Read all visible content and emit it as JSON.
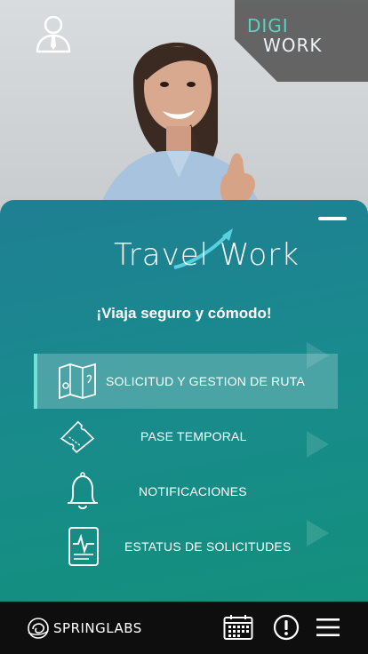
{
  "header": {
    "brand_digi": "DIGI",
    "brand_work": "WORK",
    "user_icon": "user-tie-icon"
  },
  "panel": {
    "logo_text": "Travel Work",
    "tagline": "¡Viaja seguro y cómodo!"
  },
  "menu": [
    {
      "label": "SOLICITUD Y GESTION DE RUTA",
      "icon": "map-route-icon",
      "active": true
    },
    {
      "label": "PASE TEMPORAL",
      "icon": "ticket-icon",
      "active": false
    },
    {
      "label": "NOTIFICACIONES",
      "icon": "bell-icon",
      "active": false
    },
    {
      "label": "ESTATUS DE SOLICITUDES",
      "icon": "status-report-icon",
      "active": false
    }
  ],
  "bottom_bar": {
    "brand": "SPRINGLABS",
    "icons": [
      "calendar-icon",
      "alert-icon",
      "hamburger-menu-icon"
    ]
  },
  "colors": {
    "accent": "#6fe2d3",
    "panel_top": "#1f7f93",
    "panel_bottom": "#13907d",
    "bar": "#0e0e0e"
  }
}
